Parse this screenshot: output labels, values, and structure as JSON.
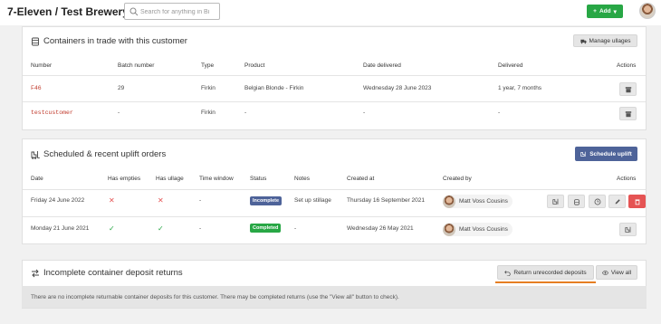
{
  "app": {
    "title": "7-Eleven / Test Brewery"
  },
  "search": {
    "placeholder": "Search for anything in Bi"
  },
  "header": {
    "add_label": "Add"
  },
  "containers": {
    "title": "Containers in trade with this customer",
    "manage_label": "Manage ullages",
    "headers": {
      "number": "Number",
      "batch": "Batch number",
      "type": "Type",
      "product": "Product",
      "date_delivered": "Date delivered",
      "delivered": "Delivered",
      "actions": "Actions"
    },
    "rows": [
      {
        "number": "F46",
        "batch": "29",
        "type": "Firkin",
        "product": "Belgian Blonde - Firkin",
        "date_delivered": "Wednesday 28 June 2023",
        "delivered": "1 year, 7 months"
      },
      {
        "number": "testcustomer",
        "batch": "-",
        "type": "Firkin",
        "product": "-",
        "date_delivered": "-",
        "delivered": "-"
      }
    ]
  },
  "uplift": {
    "title": "Scheduled & recent uplift orders",
    "schedule_label": "Schedule uplift",
    "headers": {
      "date": "Date",
      "has_empties": "Has empties",
      "has_ullage": "Has ullage",
      "time_window": "Time window",
      "status": "Status",
      "notes": "Notes",
      "created_at": "Created at",
      "created_by": "Created by",
      "actions": "Actions"
    },
    "rows": [
      {
        "date": "Friday 24 June 2022",
        "has_empties": "✕",
        "has_ullage": "✕",
        "time_window": "-",
        "status": "Incomplete",
        "notes": "Set up stillage",
        "created_at": "Thursday 16 September 2021",
        "created_by": "Matt Voss Cousins"
      },
      {
        "date": "Monday 21 June 2021",
        "has_empties": "✓",
        "has_ullage": "✓",
        "time_window": "-",
        "status": "Completed",
        "notes": "-",
        "created_at": "Wednesday 26 May 2021",
        "created_by": "Matt Voss Cousins"
      }
    ]
  },
  "deposits": {
    "title": "Incomplete container deposit returns",
    "return_label": "Return unrecorded deposits",
    "view_all_label": "View all",
    "notice": "There are no incomplete returnable container deposits for this customer. There may be completed returns (use the \"View all\" button to check)."
  },
  "colors": {
    "add": "#28a745",
    "primary": "#4e6399",
    "danger": "#e55353",
    "code": "#c0392b",
    "accent_underline": "#e67e22"
  }
}
